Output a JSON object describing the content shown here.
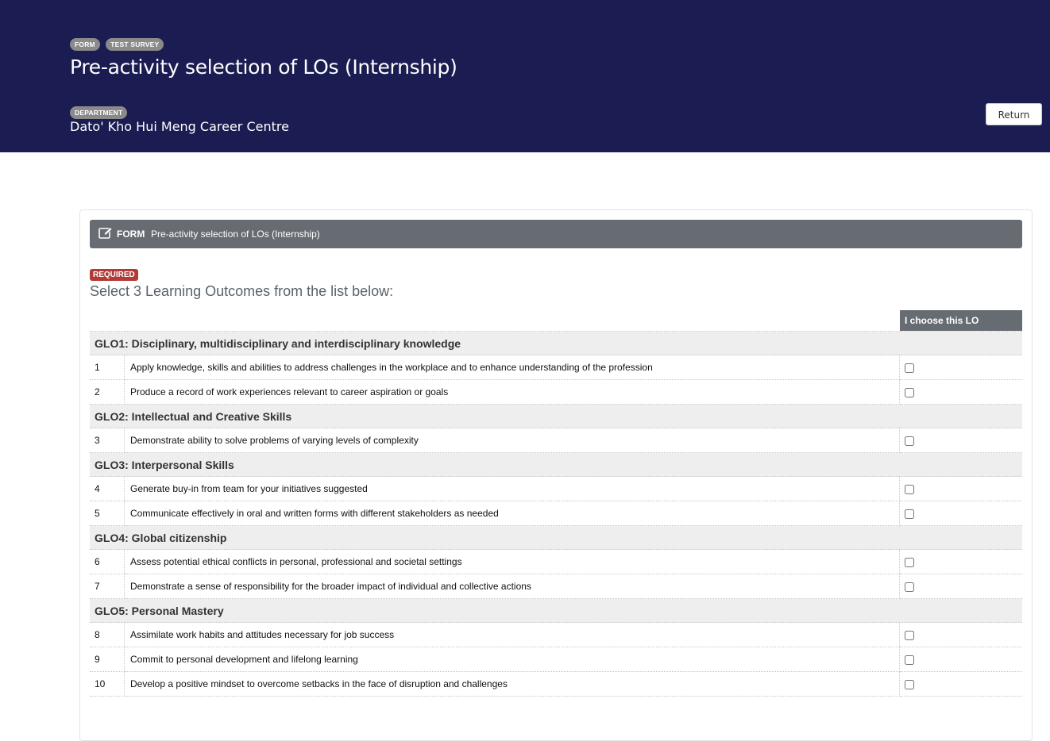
{
  "header": {
    "tags": [
      "FORM",
      "TEST SURVEY"
    ],
    "title": "Pre-activity selection of LOs (Internship)",
    "department_tag": "DEPARTMENT",
    "department": "Dato' Kho Hui Meng Career Centre",
    "return_label": "Return",
    "background": "#1a1c52"
  },
  "form": {
    "bar_label": "FORM",
    "bar_name": "Pre-activity selection of LOs (Internship)",
    "edit_icon": "edit-icon",
    "required_badge": "REQUIRED",
    "instruction": "Select 3 Learning Outcomes from the list below:",
    "column_header": "I choose this LO",
    "groups": [
      {
        "title": "GLO1: Disciplinary, multidisciplinary and interdisciplinary knowledge",
        "items": [
          {
            "num": "1",
            "text": "Apply knowledge, skills and abilities to address challenges in the workplace and to enhance understanding of the profession",
            "checked": false
          },
          {
            "num": "2",
            "text": "Produce a record of work experiences relevant to career aspiration or goals",
            "checked": false
          }
        ]
      },
      {
        "title": "GLO2: Intellectual and Creative Skills",
        "items": [
          {
            "num": "3",
            "text": "Demonstrate ability to solve problems of varying levels of complexity",
            "checked": false
          }
        ]
      },
      {
        "title": "GLO3: Interpersonal Skills",
        "items": [
          {
            "num": "4",
            "text": "Generate buy-in from team for your initiatives suggested",
            "checked": false
          },
          {
            "num": "5",
            "text": "Communicate effectively in oral and written forms with different stakeholders as needed",
            "checked": false
          }
        ]
      },
      {
        "title": "GLO4: Global citizenship",
        "items": [
          {
            "num": "6",
            "text": "Assess potential ethical conflicts in personal, professional and societal settings",
            "checked": false
          },
          {
            "num": "7",
            "text": "Demonstrate a sense of responsibility for the broader impact of individual and collective actions",
            "checked": false
          }
        ]
      },
      {
        "title": "GLO5: Personal Mastery",
        "items": [
          {
            "num": "8",
            "text": "Assimilate work habits and attitudes necessary for job success",
            "checked": false
          },
          {
            "num": "9",
            "text": "Commit to personal development and lifelong learning",
            "checked": false
          },
          {
            "num": "10",
            "text": "Develop a positive mindset to overcome setbacks in the face of disruption and challenges",
            "checked": false
          }
        ]
      }
    ]
  }
}
